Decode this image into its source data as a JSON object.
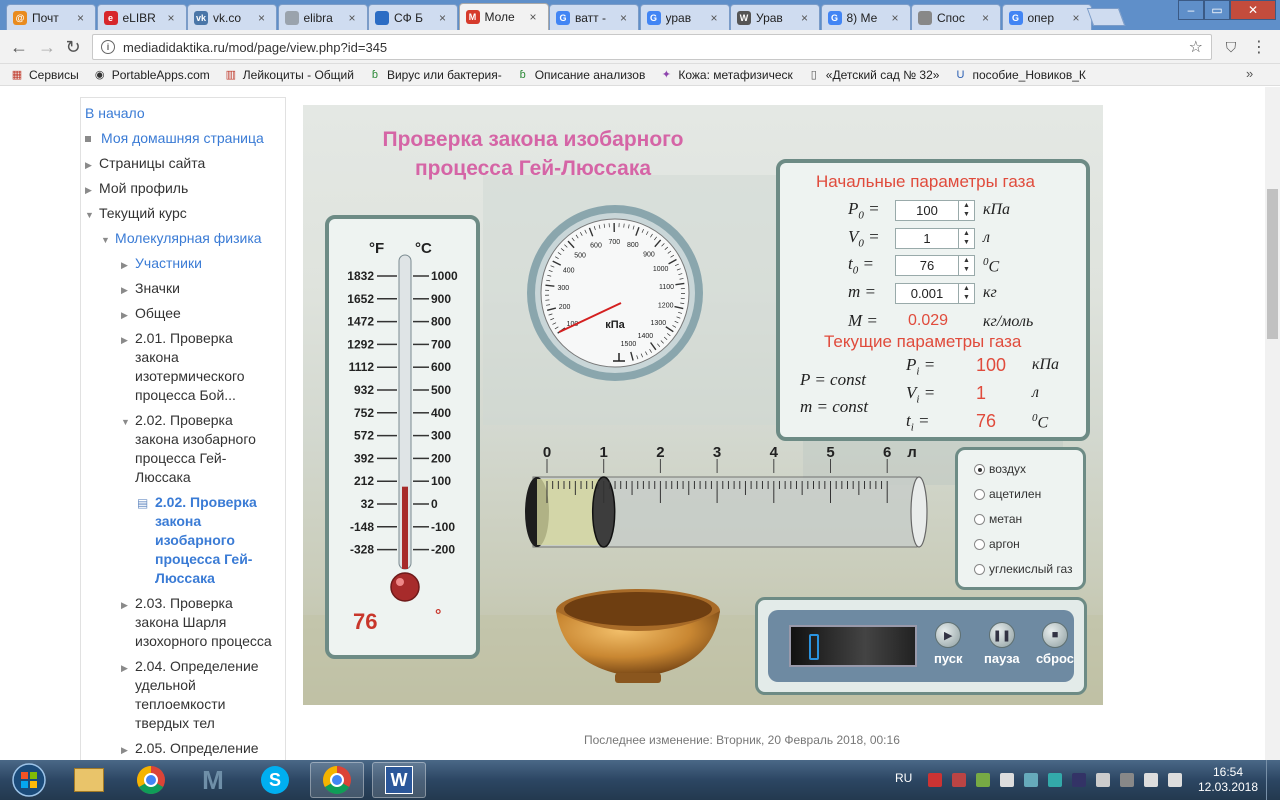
{
  "browser": {
    "tabs": [
      {
        "label": "Почт",
        "fav": "@",
        "color": "#e98b1e"
      },
      {
        "label": "eLIBR",
        "fav": "e",
        "color": "#d7262b"
      },
      {
        "label": "vk.co",
        "fav": "vk",
        "color": "#4a76a8"
      },
      {
        "label": "elibra",
        "fav": "",
        "color": "#9aa3ad"
      },
      {
        "label": "СФ Б",
        "fav": "",
        "color": "#2b6cc4"
      },
      {
        "label": "Моле",
        "fav": "М",
        "color": "#d63b2b"
      },
      {
        "label": "ватт -",
        "fav": "G",
        "color": "#4285f4"
      },
      {
        "label": "урав",
        "fav": "G",
        "color": "#4285f4"
      },
      {
        "label": "Урав",
        "fav": "W",
        "color": "#555555"
      },
      {
        "label": "8) Ме",
        "fav": "G",
        "color": "#4285f4"
      },
      {
        "label": "Спос",
        "fav": "",
        "color": "#888888"
      },
      {
        "label": "опер",
        "fav": "G",
        "color": "#4285f4"
      }
    ],
    "active_tab": 5,
    "window_buttons": [
      "–",
      "▭",
      "✕"
    ],
    "url": "mediadidaktika.ru/mod/page/view.php?id=345",
    "bookmarks": [
      {
        "label": "Сервисы",
        "icon": "apps-grid-icon"
      },
      {
        "label": "PortableApps.com",
        "icon": "portableapps-icon"
      },
      {
        "label": "Лейкоциты - Общий",
        "icon": "bookmark-red-icon"
      },
      {
        "label": "Вирус или бактерия-",
        "icon": "bookmark-green-icon"
      },
      {
        "label": "Описание анализов",
        "icon": "bookmark-green-icon"
      },
      {
        "label": "Кожа: метафизическ",
        "icon": "butterfly-icon"
      },
      {
        "label": "«Детский сад № 32»",
        "icon": "page-icon"
      },
      {
        "label": "пособие_Новиков_К",
        "icon": "u-icon"
      }
    ]
  },
  "sidebar": {
    "items": [
      {
        "label": "В начало",
        "level": 0,
        "marker": "none",
        "link": true
      },
      {
        "label": "Моя домашняя страница",
        "level": 0,
        "marker": "square",
        "link": true
      },
      {
        "label": "Страницы сайта",
        "level": 0,
        "marker": "right",
        "link": false
      },
      {
        "label": "Мой профиль",
        "level": 0,
        "marker": "right",
        "link": false
      },
      {
        "label": "Текущий курс",
        "level": 0,
        "marker": "down",
        "link": false
      },
      {
        "label": "Молекулярная физика",
        "level": 1,
        "marker": "down",
        "link": true
      },
      {
        "label": "Участники",
        "level": 2,
        "marker": "right",
        "link": true
      },
      {
        "label": "Значки",
        "level": 2,
        "marker": "right",
        "link": false
      },
      {
        "label": "Общее",
        "level": 2,
        "marker": "right",
        "link": false
      },
      {
        "lines": [
          "2.01. Проверка",
          "закона",
          "изотермического",
          "процесса Бой..."
        ],
        "level": 2,
        "marker": "right",
        "link": false
      },
      {
        "lines": [
          "2.02. Проверка",
          "закона изобарного",
          "процесса Гей-",
          "Люссака"
        ],
        "level": 2,
        "marker": "down",
        "link": false
      },
      {
        "lines": [
          "2.02. Проверка",
          "закона",
          "изобарного",
          "процесса Гей-",
          "Люссака"
        ],
        "level": 3,
        "marker": "page",
        "link": true,
        "current": true
      },
      {
        "lines": [
          "2.03. Проверка",
          "закона Шарля",
          "изохорного процесса"
        ],
        "level": 2,
        "marker": "right",
        "link": false
      },
      {
        "lines": [
          "2.04. Определение",
          "удельной",
          "теплоемкости",
          "твердых тел"
        ],
        "level": 2,
        "marker": "right",
        "link": false
      },
      {
        "lines": [
          "2.05. Определение"
        ],
        "level": 2,
        "marker": "right",
        "link": false
      }
    ]
  },
  "sim": {
    "title_line1": "Проверка закона изобарного",
    "title_line2": "процесса Гей-Люссака",
    "thermometer": {
      "f_label": "°F",
      "c_label": "°C",
      "f_ticks": [
        "1832",
        "1652",
        "1472",
        "1292",
        "1112",
        "932",
        "752",
        "572",
        "392",
        "212",
        "32",
        "-148",
        "-328"
      ],
      "c_ticks": [
        "1000",
        "900",
        "800",
        "700",
        "600",
        "500",
        "400",
        "300",
        "200",
        "100",
        "0",
        "-100",
        "-200"
      ],
      "reading": "76",
      "reading_unit": "°",
      "level_c": 76
    },
    "gauge": {
      "unit": "кПа",
      "labels": [
        "100",
        "200",
        "300",
        "400",
        "500",
        "600",
        "700",
        "800",
        "900",
        "1000",
        "1100",
        "1200",
        "1300",
        "1400",
        "1500"
      ],
      "value": 100
    },
    "initial": {
      "title": "Начальные параметры газа",
      "rows": [
        {
          "sym": "P",
          "sub": "0",
          "value": "100",
          "unit": "кПа"
        },
        {
          "sym": "V",
          "sub": "0",
          "value": "1",
          "unit": "л"
        },
        {
          "sym": "t",
          "sub": "0",
          "value": "76",
          "unit": "C",
          "unit_sup": "0"
        },
        {
          "sym": "m",
          "sub": "",
          "value": "0.001",
          "unit": "кг"
        }
      ],
      "molar": {
        "sym": "M",
        "value": "0.029",
        "unit": "кг/моль"
      }
    },
    "current": {
      "title": "Текущие параметры газа",
      "conditions": [
        "P = const",
        "m = const"
      ],
      "rows": [
        {
          "sym": "P",
          "sub": "i",
          "value": "100",
          "unit": "кПа"
        },
        {
          "sym": "V",
          "sub": "i",
          "value": "1",
          "unit": "л"
        },
        {
          "sym": "t",
          "sub": "i",
          "value": "76",
          "unit": "C",
          "unit_sup": "0"
        }
      ]
    },
    "cylinder": {
      "scale": [
        "0",
        "1",
        "2",
        "3",
        "4",
        "5",
        "6"
      ],
      "unit": "л",
      "volume": 1
    },
    "gases": [
      "воздух",
      "ацетилен",
      "метан",
      "аргон",
      "углекислый газ"
    ],
    "selected_gas": 0,
    "controls": [
      {
        "label": "пуск",
        "icon": "play-icon",
        "glyph": "▶"
      },
      {
        "label": "пауза",
        "icon": "pause-icon",
        "glyph": "❚❚"
      },
      {
        "label": "сброс",
        "icon": "stop-icon",
        "glyph": "■"
      }
    ]
  },
  "footer": "Последнее изменение: Вторник, 20 Февраль 2018, 00:16",
  "taskbar": {
    "apps": [
      {
        "name": "start-orb",
        "open": false
      },
      {
        "name": "explorer-app",
        "open": false
      },
      {
        "name": "chrome-app",
        "open": false
      },
      {
        "name": "maxthon-app",
        "open": false
      },
      {
        "name": "skype-app",
        "open": false
      },
      {
        "name": "chrome-active-app",
        "open": true
      },
      {
        "name": "word-app",
        "open": true
      }
    ],
    "lang": "RU",
    "time": "16:54",
    "date": "12.03.2018"
  }
}
